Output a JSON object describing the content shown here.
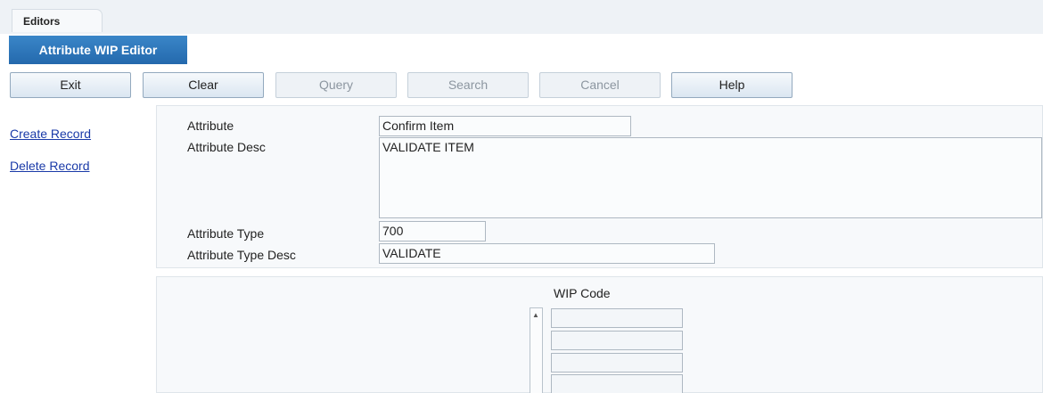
{
  "tabs": {
    "editors_label": "Editors",
    "active_editor_label": "Attribute WIP Editor"
  },
  "toolbar": {
    "exit_label": "Exit",
    "clear_label": "Clear",
    "query_label": "Query",
    "search_label": "Search",
    "cancel_label": "Cancel",
    "help_label": "Help"
  },
  "sidebar": {
    "create_record": "Create Record",
    "delete_record": "Delete Record"
  },
  "form": {
    "attribute_label": "Attribute",
    "attribute_value": "Confirm Item",
    "attribute_desc_label": "Attribute Desc",
    "attribute_desc_value": "VALIDATE ITEM",
    "attribute_type_label": "Attribute Type",
    "attribute_type_value": "700",
    "attribute_type_desc_label": "Attribute Type Desc",
    "attribute_type_desc_value": "VALIDATE"
  },
  "wip": {
    "header": "WIP Code",
    "rows": [
      "",
      "",
      "",
      ""
    ]
  },
  "colors": {
    "tab_blue": "#2c75bb",
    "link_blue": "#1a3aa8",
    "panel_bg": "#f7f9fb"
  }
}
